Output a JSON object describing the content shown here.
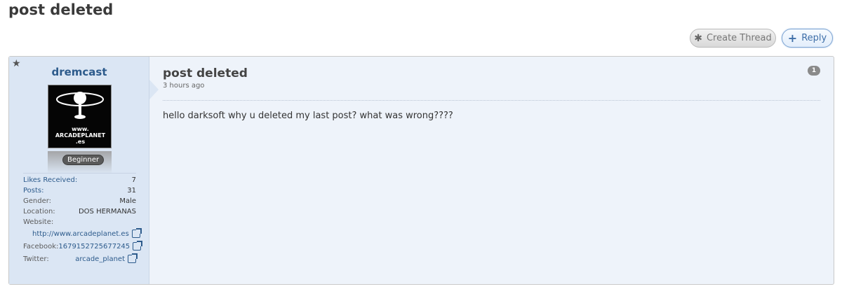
{
  "page": {
    "title": "post deleted"
  },
  "toolbar": {
    "create_thread_label": "Create Thread",
    "create_thread_icon": "asterisk-icon",
    "reply_label": "Reply",
    "reply_icon": "plus-icon"
  },
  "post": {
    "author": {
      "username": "dremcast",
      "avatar_text": [
        "www.",
        "ARCADEPLANET",
        ".es"
      ],
      "rank": "Beginner",
      "stats": [
        {
          "key": "Likes Received:",
          "value": "7"
        },
        {
          "key": "Posts:",
          "value": "31"
        },
        {
          "key": "Gender:",
          "value": "Male"
        },
        {
          "key": "Location:",
          "value": "DOS HERMANAS"
        },
        {
          "key": "Website:",
          "value": ""
        }
      ],
      "website": "http://www.arcadeplanet.es",
      "facebook_label": "Facebook:",
      "facebook": "1679152725677245",
      "twitter_label": "Twitter:",
      "twitter": "arcade_planet"
    },
    "title": "post deleted",
    "time": "3 hours ago",
    "number": "1",
    "body": "hello darksoft why u deleted my last post? what was wrong????"
  },
  "colors": {
    "accent": "#2d5b8c",
    "panel_bg": "#eef3fa",
    "user_bg": "#dbe6f4"
  }
}
